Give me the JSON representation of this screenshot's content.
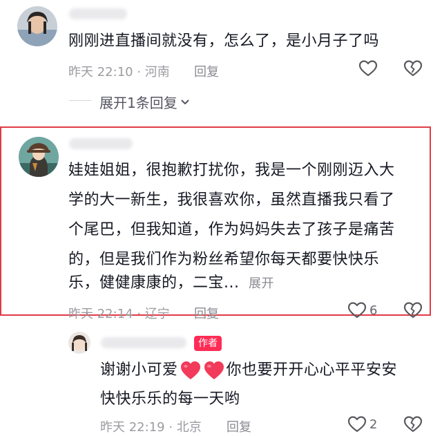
{
  "comments": [
    {
      "content": "刚刚进直播间就没有，怎么了，是小月子了吗",
      "time": "昨天 22:10",
      "location": "河南",
      "reply_label": "回复",
      "expand_replies": "展开1条回复"
    },
    {
      "content_lines": [
        "娃娃姐姐，很抱歉打扰你，我是一个刚刚迈入大",
        "学的大一新生，我很喜欢你，虽然直播我只看了",
        "个尾巴，但我知道，作为妈妈失去了孩子是痛苦",
        "的，但是我们作为粉丝希望你每天都要快快乐",
        "乐，健健康康的，二宝..."
      ],
      "more_label": "展开",
      "time": "昨天 22:14",
      "location": "辽宁",
      "reply_label": "回复",
      "like_count": "6"
    },
    {
      "author_tag": "作者",
      "content_before_hearts": "谢谢小可爱",
      "content_after_hearts": "你也要开开心心平平安安",
      "content_line2": "快快乐乐的每一天哟",
      "time": "昨天 22:19",
      "location": "北京",
      "reply_label": "回复",
      "like_count": "2"
    }
  ],
  "colors": {
    "highlight_border": "#e03a46",
    "author_tag": "#fe2c55",
    "heart_emoji": "#f23a5a"
  },
  "icons": [
    "like-heart-icon",
    "dislike-broken-heart-icon",
    "chevron-down-icon",
    "red-heart-emoji-icon"
  ]
}
